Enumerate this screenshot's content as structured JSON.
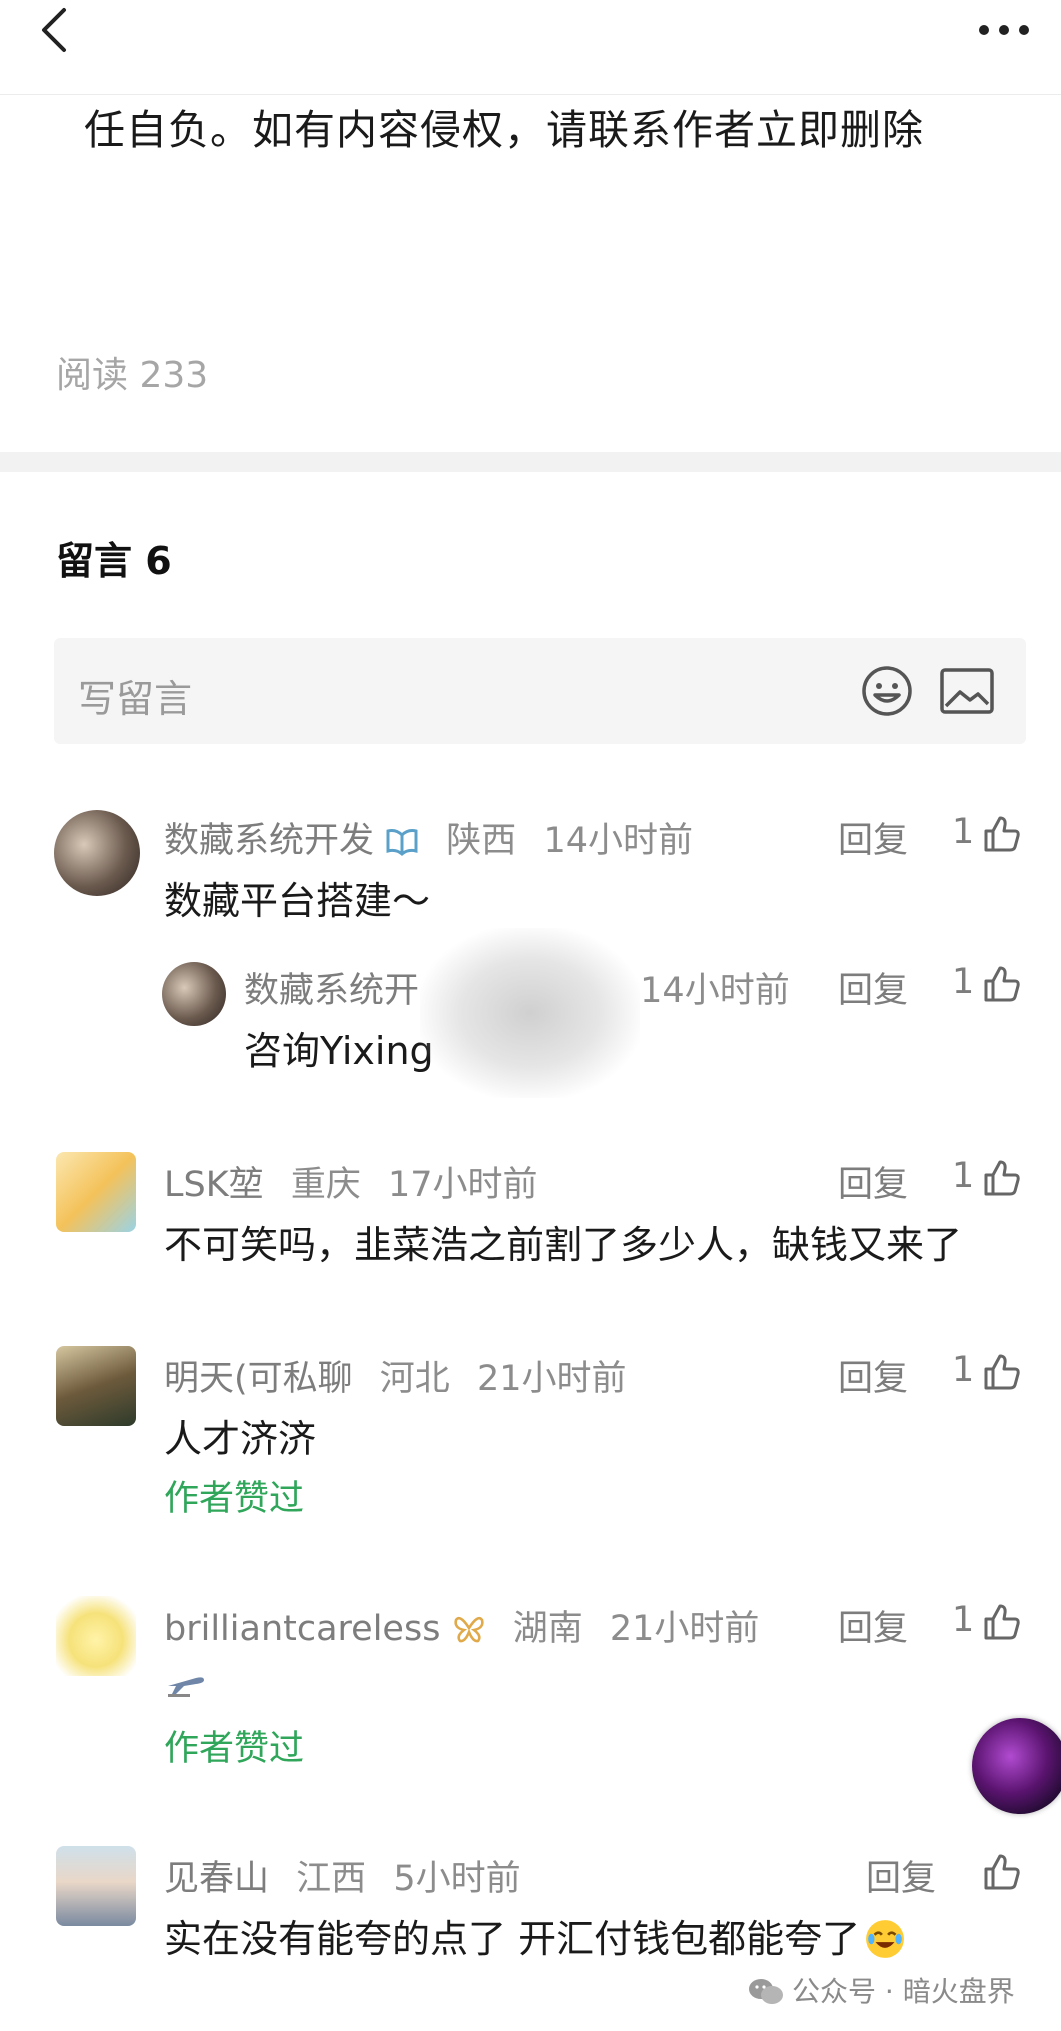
{
  "article": {
    "tail_text": "任自负。如有内容侵权，请联系作者立即删除",
    "reads": "阅读 233"
  },
  "comments_section": {
    "title": "留言 6",
    "input_placeholder": "写留言"
  },
  "actions": {
    "reply": "回复"
  },
  "comments": [
    {
      "name": "数藏系统开发",
      "location": "陕西",
      "time": "14小时前",
      "text": "数藏平台搭建～",
      "likes": "1",
      "reply": {
        "name": "数藏系统开",
        "time": "14小时前",
        "text": "咨询Yixing",
        "likes": "1"
      }
    },
    {
      "name": "LSK堃",
      "location": "重庆",
      "time": "17小时前",
      "text": "不可笑吗，韭菜浩之前割了多少人，缺钱又来了",
      "likes": "1"
    },
    {
      "name": "明天(可私聊",
      "location": "河北",
      "time": "21小时前",
      "text": "人才济济",
      "likes": "1",
      "author_liked": "作者赞过"
    },
    {
      "name": "brilliantcareless",
      "location": "湖南",
      "time": "21小时前",
      "text": "",
      "likes": "1",
      "author_liked": "作者赞过"
    },
    {
      "name": "见春山",
      "location": "江西",
      "time": "5小时前",
      "text": "实在没有能夸的点了 开汇付钱包都能夸了",
      "likes": ""
    }
  ],
  "watermark": {
    "dot": "公众号 · 暗火盘界"
  },
  "colors": {
    "author_liked": "#2fa65a",
    "meta": "#8c8c8c",
    "gap": "#f2f2f2"
  }
}
